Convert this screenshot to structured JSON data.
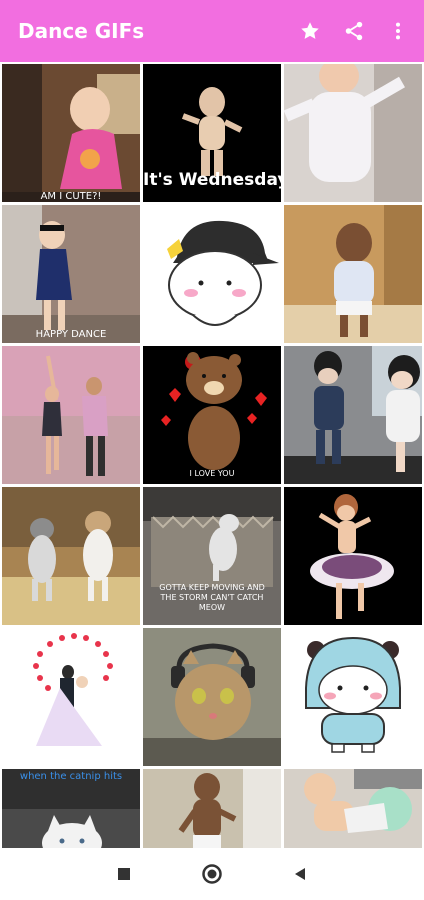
{
  "appbar": {
    "title": "Dance GIFs",
    "actions": [
      {
        "name": "favorites",
        "icon": "star-icon"
      },
      {
        "name": "share",
        "icon": "share-icon"
      },
      {
        "name": "more",
        "icon": "more-vertical-icon"
      }
    ]
  },
  "colors": {
    "appbar": "#f26ee0",
    "nav_icons": "#333333"
  },
  "gifs": [
    {
      "caption": "AM I CUTE?!"
    },
    {
      "caption": "It's Wednesday!"
    },
    {
      "caption": ""
    },
    {
      "caption": "HAPPY DANCE"
    },
    {
      "caption": ""
    },
    {
      "caption": ""
    },
    {
      "caption": ""
    },
    {
      "caption": "I LOVE YOU"
    },
    {
      "caption": ""
    },
    {
      "caption": ""
    },
    {
      "caption": "GOTTA KEEP MOVING AND THE STORM CAN'T CATCH MEOW"
    },
    {
      "caption": ""
    },
    {
      "caption": ""
    },
    {
      "caption": ""
    },
    {
      "caption": ""
    },
    {
      "caption": "when the catnip hits"
    },
    {
      "caption": ""
    },
    {
      "caption": ""
    }
  ],
  "navbar": {
    "buttons": [
      {
        "name": "recents",
        "icon": "square-icon"
      },
      {
        "name": "home",
        "icon": "circle-icon"
      },
      {
        "name": "back",
        "icon": "triangle-left-icon"
      }
    ]
  }
}
